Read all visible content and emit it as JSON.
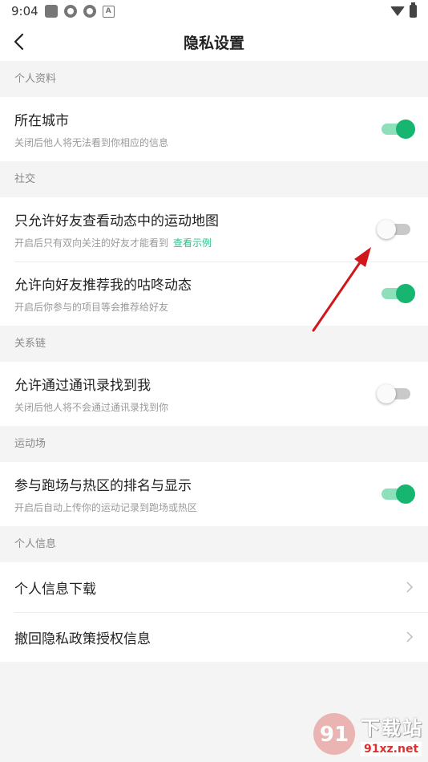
{
  "status_bar": {
    "time": "9:04"
  },
  "header": {
    "title": "隐私设置"
  },
  "sections": [
    {
      "header": "个人资料",
      "items": [
        {
          "title": "所在城市",
          "subtitle": "关闭后他人将无法看到你相应的信息",
          "toggle": "on"
        }
      ]
    },
    {
      "header": "社交",
      "items": [
        {
          "title": "只允许好友查看动态中的运动地图",
          "subtitle": "开启后只有双向关注的好友才能看到",
          "link": "查看示例",
          "toggle": "off"
        },
        {
          "title": "允许向好友推荐我的咕咚动态",
          "subtitle": "开启后你参与的项目等会推荐给好友",
          "toggle": "on"
        }
      ]
    },
    {
      "header": "关系链",
      "items": [
        {
          "title": "允许通过通讯录找到我",
          "subtitle": "关闭后他人将不会通过通讯录找到你",
          "toggle": "off"
        }
      ]
    },
    {
      "header": "运动场",
      "items": [
        {
          "title": "参与跑场与热区的排名与显示",
          "subtitle": "开启后自动上传你的运动记录到跑场或热区",
          "toggle": "on"
        }
      ]
    },
    {
      "header": "个人信息",
      "items": [
        {
          "title": "个人信息下载"
        },
        {
          "title": "撤回隐私政策授权信息"
        }
      ]
    }
  ],
  "colors": {
    "accent": "#17b670",
    "annotation_arrow": "#d0181c"
  },
  "watermark": {
    "main": "下载站",
    "site": "91xz.net",
    "logo_text": "91"
  }
}
